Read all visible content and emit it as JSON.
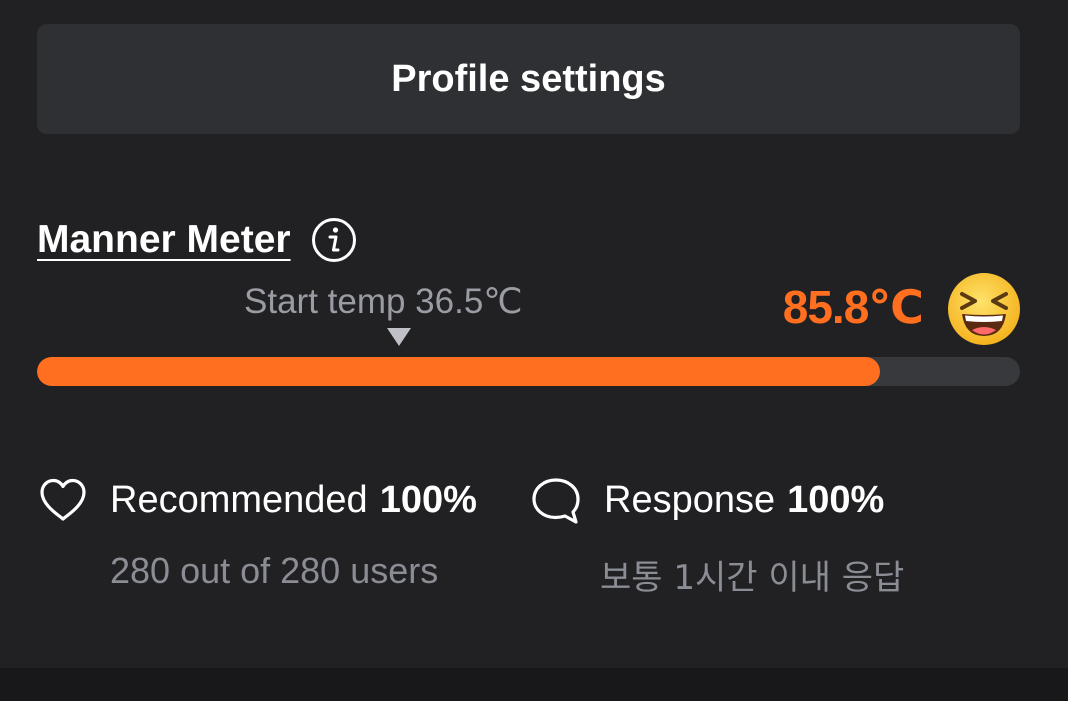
{
  "profile_button": {
    "label": "Profile settings"
  },
  "manner_meter": {
    "title": "Manner Meter",
    "info_icon": "info-circle-icon",
    "start_temp_label": "Start temp 36.5℃",
    "current_temp": "85.8℃",
    "level_fraction": 0.858,
    "mood_icon": "grinning-squinting-face-icon",
    "colors": {
      "accent": "#ff6f1f",
      "track": "#38393d",
      "marker": "#bfc1c6"
    }
  },
  "stats": {
    "recommended": {
      "icon": "heart-outline-icon",
      "label": "Recommended",
      "percent": "100%",
      "detail": "280 out of 280 users"
    },
    "response": {
      "icon": "chat-bubble-outline-icon",
      "label": "Response",
      "percent": "100%",
      "detail": "보통 1시간 이내 응답"
    }
  }
}
